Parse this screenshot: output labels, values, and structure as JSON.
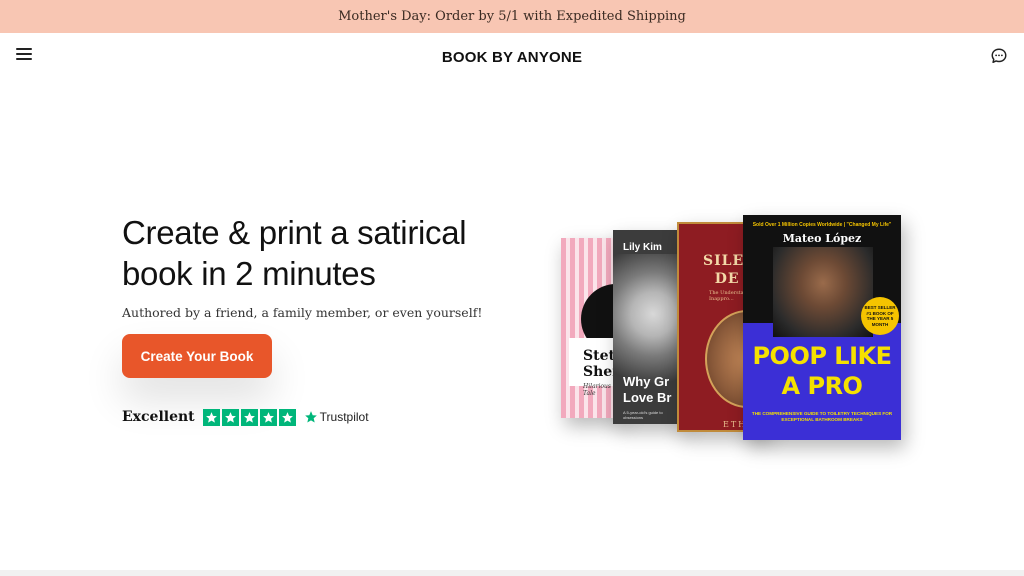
{
  "promo_banner": {
    "text": "Mother's Day: Order by 5/1 with Expedited Shipping",
    "background": "#f8c6b3"
  },
  "header": {
    "logo": "BOOK BY ANYONE",
    "menu_icon": "hamburger-menu-icon",
    "chat_icon": "chat-bubble-icon"
  },
  "hero": {
    "title_line1": "Create & print a satirical",
    "title_line2": "book in 2 minutes",
    "subtitle": "Authored by a friend, a family member, or even yourself!",
    "cta_label": "Create Your Book",
    "cta_color": "#e8562a"
  },
  "trustpilot": {
    "rating_label": "Excellent",
    "stars": 5,
    "brand": "Trustpilot",
    "star_color": "#00b67a"
  },
  "books": [
    {
      "title_line1": "Stetl",
      "title_line2": "Shen",
      "subtitle": "Hilarious Tale"
    },
    {
      "author": "Lily Kim",
      "title_line1": "Why Gr",
      "title_line2": "Love Br",
      "blurb": "A 5-year-old's guide to obsessions"
    },
    {
      "title_line1": "SILEN",
      "title_line2": "DE",
      "small": "The Understa... Inappro...",
      "author": "ETH"
    },
    {
      "headline": "Sold Over 1 Million Copies Worldwide | \"Changed My Life\"",
      "author": "Mateo López",
      "badge": "BEST SELLER #1 BOOK OF THE YEAR 5 MONTH",
      "title_line1": "POOP LIKE",
      "title_line2": "A PRO",
      "tagline": "THE COMPREHENSIVE GUIDE TO TOILETRY TECHNIQUES FOR EXCEPTIONAL BATHROOM BREAKS"
    }
  ]
}
